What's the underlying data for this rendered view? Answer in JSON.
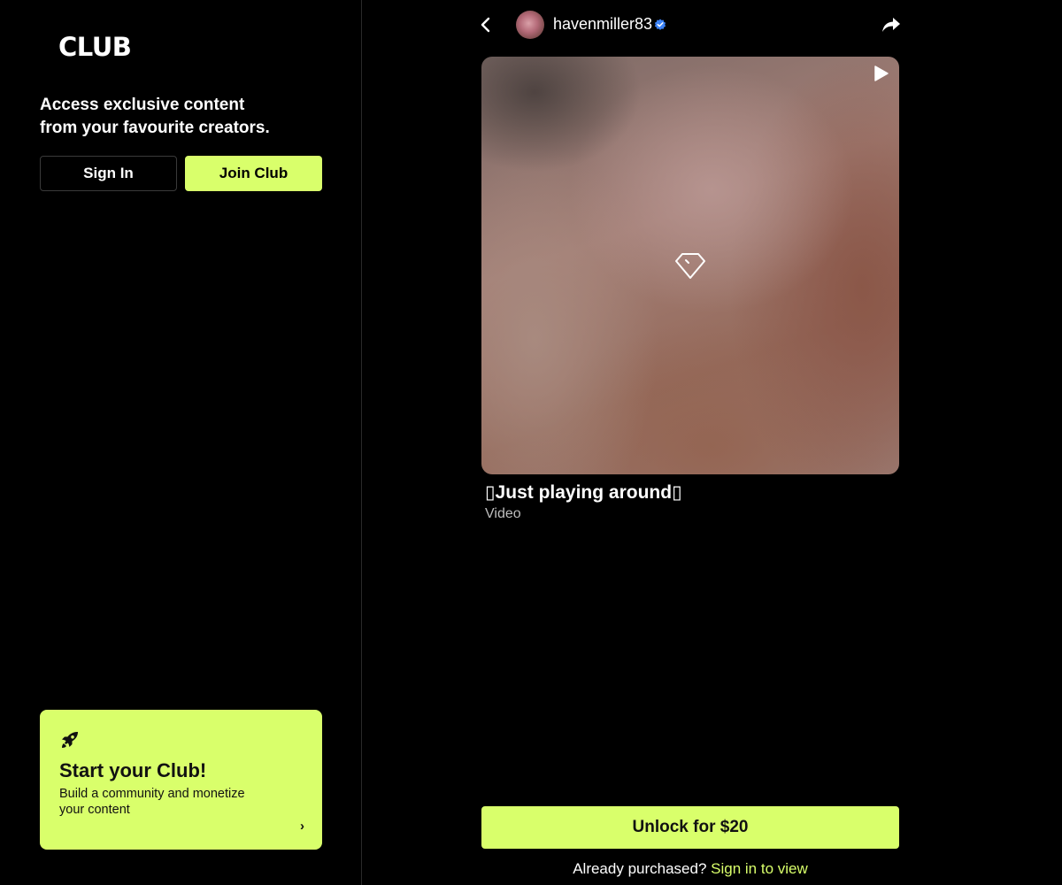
{
  "sidebar": {
    "logo": "CLUB",
    "tagline_line1": "Access exclusive content",
    "tagline_line2": "from your favourite creators.",
    "sign_in_label": "Sign In",
    "join_label": "Join Club",
    "promo": {
      "icon": "rocket-icon",
      "title": "Start your Club!",
      "description": "Build a community and monetize your content",
      "chevron": "›"
    }
  },
  "header": {
    "back_icon": "chevron-left-icon",
    "username": "havenmiller83",
    "verified_icon": "verified-badge-icon",
    "share_icon": "share-icon"
  },
  "post": {
    "media_icons": [
      "play-icon",
      "diamond-lock-icon"
    ],
    "title": "▯Just playing around▯",
    "type": "Video"
  },
  "footer": {
    "unlock_label": "Unlock for $20",
    "purchased_text": "Already purchased?",
    "sign_in_link": "Sign in to view"
  },
  "colors": {
    "accent": "#d9ff6b",
    "background": "#000000",
    "verified": "#3b82f6"
  }
}
